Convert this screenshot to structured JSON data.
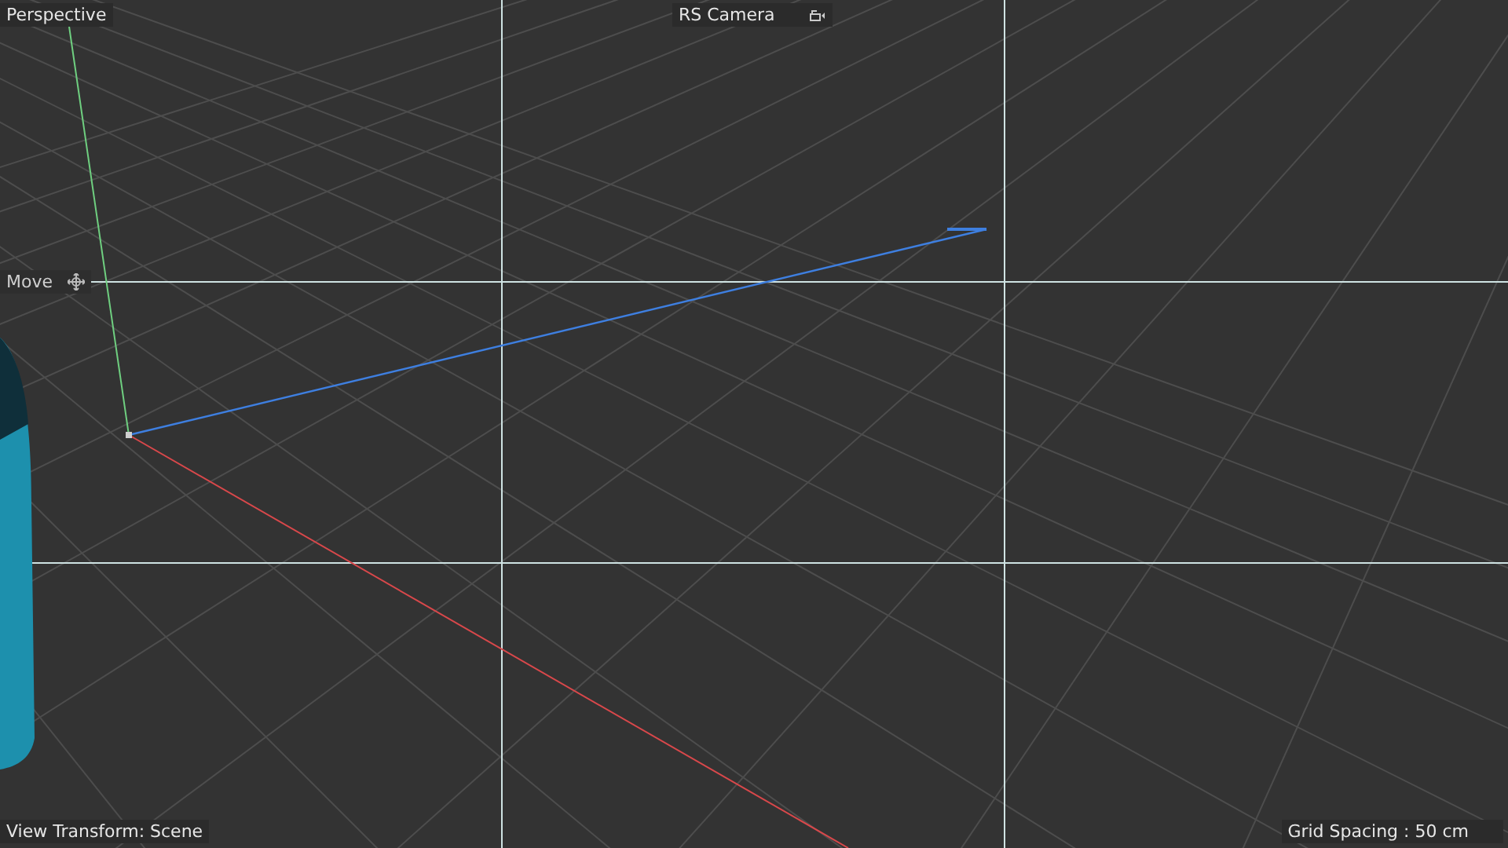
{
  "viewport": {
    "view_name": "Perspective",
    "camera": "RS Camera",
    "tool": "Move",
    "view_transform": "View Transform: Scene",
    "grid_spacing": "Grid Spacing : 50 cm"
  }
}
